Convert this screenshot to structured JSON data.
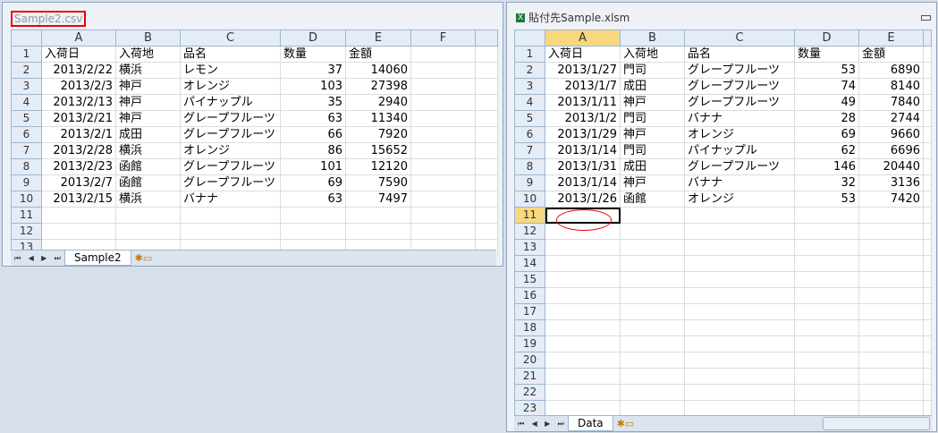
{
  "left": {
    "title": "Sample2.csv",
    "columns": [
      "A",
      "B",
      "C",
      "D",
      "E",
      "F"
    ],
    "rows": [
      [
        "入荷日",
        "入荷地",
        "品名",
        "数量",
        "金額"
      ],
      [
        "2013/2/22",
        "横浜",
        "レモン",
        "37",
        "14060"
      ],
      [
        "2013/2/3",
        "神戸",
        "オレンジ",
        "103",
        "27398"
      ],
      [
        "2013/2/13",
        "神戸",
        "パイナップル",
        "35",
        "2940"
      ],
      [
        "2013/2/21",
        "神戸",
        "グレープフルーツ",
        "63",
        "11340"
      ],
      [
        "2013/2/1",
        "成田",
        "グレープフルーツ",
        "66",
        "7920"
      ],
      [
        "2013/2/28",
        "横浜",
        "オレンジ",
        "86",
        "15652"
      ],
      [
        "2013/2/23",
        "函館",
        "グレープフルーツ",
        "101",
        "12120"
      ],
      [
        "2013/2/7",
        "函館",
        "グレープフルーツ",
        "69",
        "7590"
      ],
      [
        "2013/2/15",
        "横浜",
        "バナナ",
        "63",
        "7497"
      ]
    ],
    "row_count": 13,
    "sheet_tab": "Sample2"
  },
  "right": {
    "title": "貼付先Sample.xlsm",
    "columns": [
      "A",
      "B",
      "C",
      "D",
      "E"
    ],
    "rows": [
      [
        "入荷日",
        "入荷地",
        "品名",
        "数量",
        "金額"
      ],
      [
        "2013/1/27",
        "門司",
        "グレープフルーツ",
        "53",
        "6890"
      ],
      [
        "2013/1/7",
        "成田",
        "グレープフルーツ",
        "74",
        "8140"
      ],
      [
        "2013/1/11",
        "神戸",
        "グレープフルーツ",
        "49",
        "7840"
      ],
      [
        "2013/1/2",
        "門司",
        "バナナ",
        "28",
        "2744"
      ],
      [
        "2013/1/29",
        "神戸",
        "オレンジ",
        "69",
        "9660"
      ],
      [
        "2013/1/14",
        "門司",
        "パイナップル",
        "62",
        "6696"
      ],
      [
        "2013/1/31",
        "成田",
        "グレープフルーツ",
        "146",
        "20440"
      ],
      [
        "2013/1/14",
        "神戸",
        "バナナ",
        "32",
        "3136"
      ],
      [
        "2013/1/26",
        "函館",
        "オレンジ",
        "53",
        "7420"
      ]
    ],
    "row_count": 23,
    "sheet_tab": "Data",
    "active_cell": "A11"
  },
  "nav": {
    "first": "⏮",
    "prev": "◀",
    "next": "▶",
    "last": "⏭"
  }
}
